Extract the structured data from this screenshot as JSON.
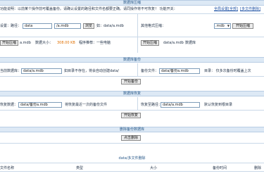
{
  "compress": {
    "title": "数据库压缩",
    "notice": "功能说明：以前某个操作前可覆盖备份。请确认设置的路径和文件名都要正确。请同操作将不可恢复！ 功能开关：",
    "link_all": "全局设置",
    "link_all_bracket": "[全部]",
    "link_test": "[多文件删除]",
    "path_label": "设置：路径：",
    "path_value": "data",
    "file_value": "/a.mdb",
    "browse_button": "浏览",
    "path_hint": "如：data/a.mdb",
    "other_label": "其他格式压缩：",
    "format_value": ".mdb",
    "compress_other_button": "开始压缩",
    "compress_button": "开始压缩",
    "db_file": "a.mdb",
    "size_label": "数据大小：",
    "size_value": "308.00 KB",
    "size_suffix": "程序推荐：一些电脑",
    "open_button": "开始压缩",
    "db_file2": "data/a.mdb",
    "db_label2": "数据库"
  },
  "backup": {
    "title": "数据库备份",
    "current_label": "当前数据库：",
    "current_value": "data/a.mdb",
    "current_hint": "如目录不存在，将会自动创建data/",
    "target_label": "备份文件：",
    "target_value": "data/备份a.mdb",
    "target_hint": "目录：  仅多次备份时覆盖上次",
    "button": "开始备份"
  },
  "restore": {
    "title": "数据库恢复",
    "source_label": "恢复数据：",
    "source_value": "data/备份a.mdb",
    "source_hint": "将恢复最近一次的备份文件",
    "target_label": "恢复至路径：",
    "target_value": "data/a.mdb",
    "target_hint": "默认恢复到根目录",
    "button": "开始恢复"
  },
  "delete": {
    "title": "删除备份数据库",
    "button": "点击删除"
  },
  "files": {
    "title": "data/多文件删除",
    "columns": [
      "文件名称",
      "类型",
      "大小",
      "备份时间",
      "删除"
    ]
  }
}
